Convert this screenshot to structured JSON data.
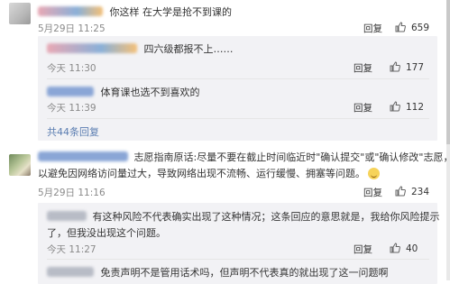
{
  "comments": [
    {
      "text": "你这样 在大学是抢不到课的",
      "time": "5月29日 11:25",
      "reply_label": "回复",
      "likes": "659",
      "replies": [
        {
          "text": "四六级都报不上……",
          "time": "今天 11:30",
          "reply_label": "回复",
          "likes": "177"
        },
        {
          "text": "体育课也选不到喜欢的",
          "time": "今天 11:39",
          "reply_label": "回复",
          "likes": "112"
        }
      ],
      "more_replies": "共44条回复"
    },
    {
      "text_line1": "志愿指南原话:尽量不要在截止时间临近时\"确认提交\"或\"确认修改\"志愿，",
      "text_line2": "以避免因网络访问量过大，导致网络出现不流畅、运行缓慢、拥塞等问题。",
      "time": "5月29日 11:16",
      "reply_label": "回复",
      "likes": "234",
      "replies": [
        {
          "text_line1": "有这种风险不代表确实出现了这种情况；这条回应的意思就是，我给你风险提示",
          "text_line2": "了，但我没出现这个问题。",
          "time": "今天 11:27",
          "reply_label": "回复",
          "likes": "40"
        },
        {
          "text": "免责声明不是管用话术吗，但声明不代表真的就出现了这一问题啊"
        }
      ]
    }
  ],
  "icons": {
    "like": "thumbs-up-icon",
    "emoji": "smile-emoji-icon"
  },
  "colors": {
    "link": "#5b7db1",
    "reply_bg": "#f2f2f5",
    "time": "#8a8a8a"
  }
}
